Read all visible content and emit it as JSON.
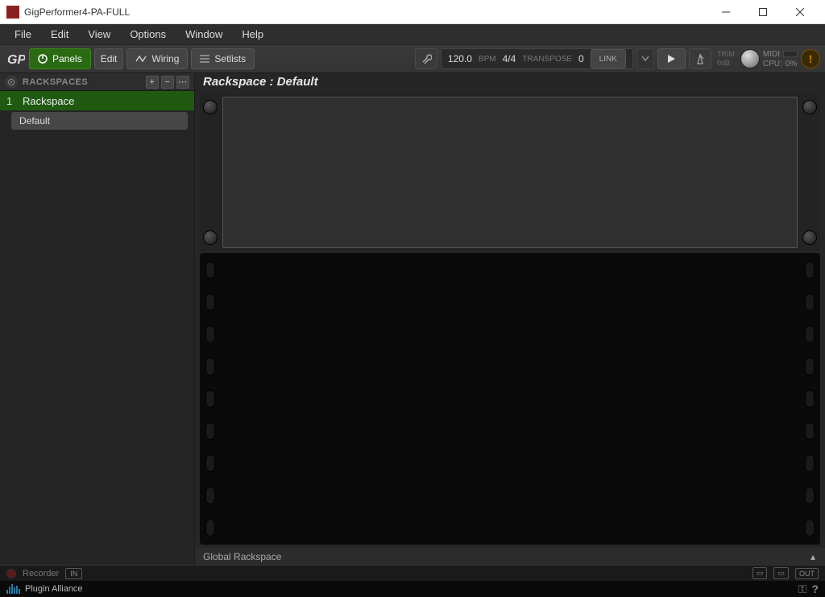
{
  "window": {
    "title": "GigPerformer4-PA-FULL"
  },
  "menu": {
    "items": [
      "File",
      "Edit",
      "View",
      "Options",
      "Window",
      "Help"
    ]
  },
  "toolbar": {
    "panels": "Panels",
    "edit": "Edit",
    "wiring": "Wiring",
    "setlists": "Setlists",
    "tempo": "120.0",
    "bpm_label": "BPM",
    "timesig": "4/4",
    "transpose_label": "TRANSPOSE",
    "transpose_value": "0",
    "link": "LINK",
    "trim_label": "TRIM",
    "trim_value": "0dB",
    "midi_label": "MIDI",
    "cpu_label": "CPU:",
    "cpu_value": "0%"
  },
  "sidebar": {
    "header": "RACKSPACES",
    "rackspaces": [
      {
        "index": "1",
        "name": "Rackspace",
        "variations": [
          "Default"
        ]
      }
    ]
  },
  "content": {
    "title": "Rackspace : Default",
    "global_rackspace": "Global Rackspace"
  },
  "recorder": {
    "label": "Recorder",
    "in_badge": "IN",
    "out_badge": "OUT"
  },
  "brand": {
    "name": "Plugin Alliance"
  }
}
